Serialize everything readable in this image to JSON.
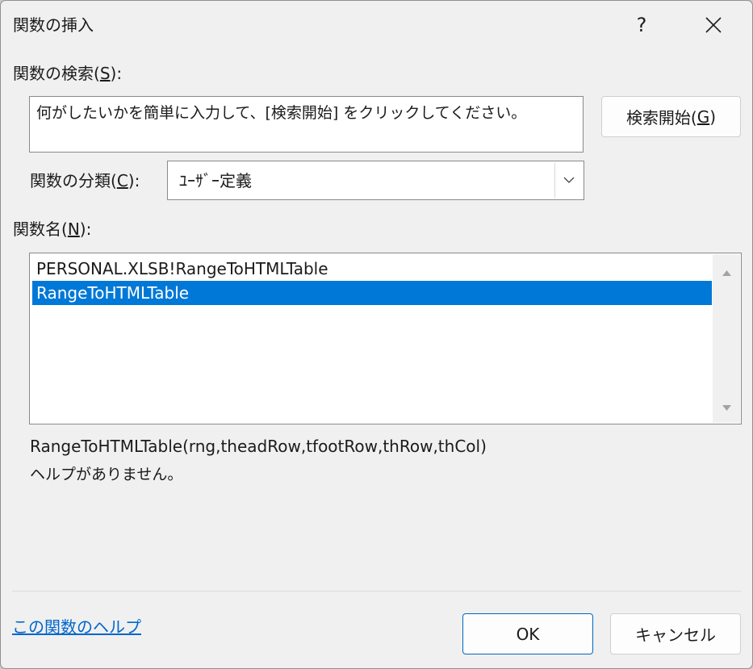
{
  "window": {
    "title": "関数の挿入",
    "help_glyph": "?"
  },
  "search": {
    "label_prefix": "関数の検索(",
    "label_accel": "S",
    "label_suffix": "):",
    "value": "何がしたいかを簡単に入力して、[検索開始] をクリックしてください。",
    "button_prefix": "検索開始(",
    "button_accel": "G",
    "button_suffix": ")"
  },
  "category": {
    "label_prefix": "関数の分類(",
    "label_accel": "C",
    "label_suffix": "):",
    "selected": "ﾕｰｻﾞｰ定義"
  },
  "functions": {
    "label_prefix": "関数名(",
    "label_accel": "N",
    "label_suffix": "):",
    "items": [
      {
        "label": "PERSONAL.XLSB!RangeToHTMLTable",
        "selected": false
      },
      {
        "label": "RangeToHTMLTable",
        "selected": true
      }
    ]
  },
  "details": {
    "signature": "RangeToHTMLTable(rng,theadRow,tfootRow,thRow,thCol)",
    "description": "ヘルプがありません。"
  },
  "footer": {
    "help_link": "この関数のヘルプ",
    "ok_label": "OK",
    "cancel_label": "キャンセル"
  },
  "colors": {
    "selection": "#0078d7",
    "link": "#0066cc",
    "primary_border": "#0067c0",
    "dialog_bg": "#f0f0f0"
  },
  "icons": {
    "close": "close-icon",
    "dropdown": "chevron-down-icon",
    "scroll_up": "scroll-up-arrow-icon",
    "scroll_down": "scroll-down-arrow-icon"
  }
}
